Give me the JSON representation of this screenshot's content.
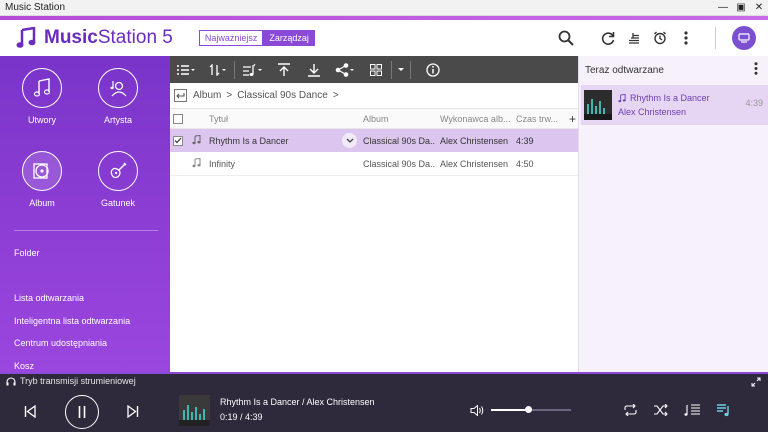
{
  "window": {
    "title": "Music Station"
  },
  "app": {
    "name_bold": "Music",
    "name_rest": "Station 5"
  },
  "header": {
    "tabs": [
      {
        "label": "Najważniejsz"
      },
      {
        "label": "Zarządzaj"
      }
    ],
    "icons": [
      "search-icon",
      "refresh-icon",
      "stacked-tracks-icon",
      "alarm-icon",
      "more-vert-icon",
      "account-icon"
    ]
  },
  "sidebar": {
    "categories": [
      {
        "label": "Utwory",
        "icon": "music-note-icon"
      },
      {
        "label": "Artysta",
        "icon": "artist-icon"
      },
      {
        "label": "Album",
        "icon": "album-disc-icon"
      },
      {
        "label": "Gatunek",
        "icon": "guitar-icon"
      }
    ],
    "links": [
      {
        "label": "Folder"
      },
      {
        "label": "Lista odtwarzania"
      },
      {
        "label": "Inteligentna lista odtwarzania"
      },
      {
        "label": "Centrum udostępniania"
      },
      {
        "label": "Kosz"
      }
    ]
  },
  "toolbar": {
    "icons": [
      "list-view-icon",
      "sort-icon",
      "add-to-playlist-icon",
      "move-top-icon",
      "download-icon",
      "share-icon",
      "grid-view-icon",
      "info-icon"
    ]
  },
  "breadcrumb": {
    "back_icon": "back-icon",
    "items": [
      "Album",
      "Classical 90s Dance"
    ],
    "separator": ">"
  },
  "table": {
    "columns": {
      "title": "Tytuł",
      "album": "Album",
      "artist": "Wykonawca alb...",
      "duration": "Czas trw..."
    },
    "rows": [
      {
        "title": "Rhythm Is a Dancer",
        "album": "Classical 90s Da...",
        "artist": "Alex Christensen",
        "duration": "4:39",
        "checked": true
      },
      {
        "title": "Infinity",
        "album": "Classical 90s Da...",
        "artist": "Alex Christensen",
        "duration": "4:50",
        "checked": false
      }
    ]
  },
  "now_playing_panel": {
    "title": "Teraz odtwarzane",
    "item": {
      "title": "Rhythm Is a Dancer",
      "artist": "Alex Christensen",
      "duration": "4:39"
    }
  },
  "player": {
    "stream_label": "Tryb transmisji strumieniowej",
    "track": "Rhythm Is a Dancer / Alex Christensen",
    "time": "0:19 / 4:39",
    "volume": 0.46
  },
  "colors": {
    "accent": "#8a49d6",
    "sidebar": "#7a34c9",
    "player_bg": "#2e2a3b",
    "selected_row": "#dcc6f0"
  }
}
